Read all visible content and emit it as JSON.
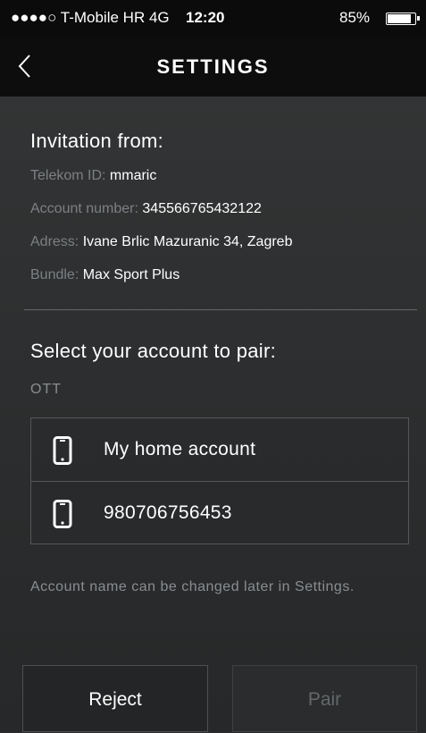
{
  "status_bar": {
    "carrier": "●●●●○ T-Mobile HR 4G",
    "time": "12:20",
    "battery": "85%",
    "battery_level": 0.85
  },
  "nav": {
    "title": "SETTINGS",
    "back_icon": "chevron-left-icon"
  },
  "invitation": {
    "heading": "Invitation from:",
    "rows": [
      {
        "label": "Telekom ID: ",
        "value": "mmaric"
      },
      {
        "label": "Account number: ",
        "value": "345566765432122"
      },
      {
        "label": "Adress: ",
        "value": "Ivane Brlic Mazuranic 34, Zagreb"
      },
      {
        "label": "Bundle: ",
        "value": "Max Sport Plus"
      }
    ]
  },
  "pairing": {
    "heading": "Select your account to pair:",
    "section": "OTT",
    "accounts": [
      {
        "name": "My home account",
        "icon": "phone-icon"
      },
      {
        "name": "980706756453",
        "icon": "phone-icon"
      }
    ],
    "note": "Account name can be changed later in Settings."
  },
  "buttons": {
    "reject": "Reject",
    "pair": "Pair"
  },
  "colors": {
    "background": "#2b2c2d",
    "bar": "#0d0d0d",
    "muted_text": "#7d8083",
    "disabled_text": "#65686b"
  }
}
